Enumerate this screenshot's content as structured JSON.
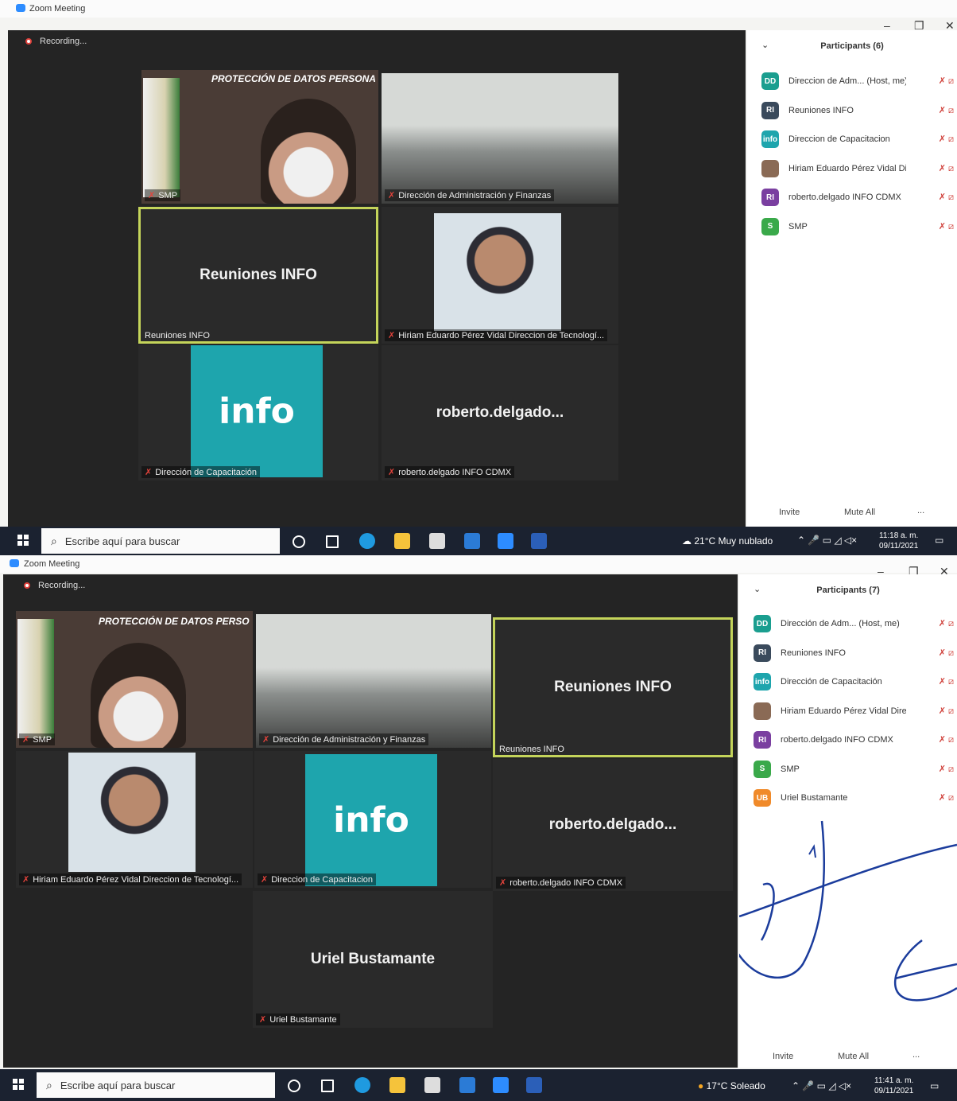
{
  "colors": {
    "accent": "#2d8cff",
    "muted_red": "#e3433b",
    "active_border": "#c4d45a",
    "info_teal": "#1ea5ad",
    "taskbar": "#1b2230"
  },
  "shot1": {
    "window_title": "Zoom Meeting",
    "recording": "Recording...",
    "banner": "PROTECCIÓN DE DATOS PERSONA",
    "tiles": {
      "smp": "SMP",
      "direccion_admin": "Dirección de Administración y Finanzas",
      "reuniones_big": "Reuniones INFO",
      "reuniones_label": "Reuniones INFO",
      "hiriam": "Hiriam Eduardo Pérez Vidal Direccion de Tecnologí...",
      "info_logo": "info",
      "capacitacion": "Dirección de Capacitación",
      "roberto_big": "roberto.delgado...",
      "roberto_label": "roberto.delgado INFO CDMX"
    },
    "participants_header": "Participants (6)",
    "participants": [
      {
        "initials": "DD",
        "name": "Direccion de Adm... (Host, me)",
        "color": "#1a9e8f"
      },
      {
        "initials": "RI",
        "name": "Reuniones INFO",
        "color": "#3a4a5c"
      },
      {
        "initials": "info",
        "name": "Direccion de Capacitacion",
        "color": "#1ea5ad"
      },
      {
        "initials": "",
        "name": "Hiriam Eduardo Pérez Vidal Dire...",
        "color": "#8a6a55"
      },
      {
        "initials": "RI",
        "name": "roberto.delgado INFO CDMX",
        "color": "#7a3fa0"
      },
      {
        "initials": "S",
        "name": "SMP",
        "color": "#3aa94a"
      }
    ],
    "invite": "Invite",
    "mute_all": "Mute All",
    "more": "...",
    "search_placeholder": "Escribe aquí para buscar",
    "weather": "21°C  Muy nublado",
    "time": "11:18 a. m.",
    "date": "09/11/2021"
  },
  "shot2": {
    "window_title": "Zoom Meeting",
    "recording": "Recording...",
    "banner": "PROTECCIÓN DE DATOS PERSO",
    "tiles": {
      "smp": "SMP",
      "direccion_admin": "Dirección de Administración y Finanzas",
      "reuniones_big": "Reuniones INFO",
      "reuniones_label": "Reuniones INFO",
      "hiriam": "Hiriam Eduardo Pérez Vidal Direccion de Tecnologí...",
      "info_logo": "info",
      "capacitacion": "Direccion de Capacitacion",
      "roberto_big": "roberto.delgado...",
      "roberto_label": "roberto.delgado INFO CDMX",
      "uriel_big": "Uriel Bustamante",
      "uriel_label": "Uriel Bustamante"
    },
    "participants_header": "Participants (7)",
    "participants": [
      {
        "initials": "DD",
        "name": "Dirección de Adm... (Host, me)",
        "color": "#1a9e8f"
      },
      {
        "initials": "RI",
        "name": "Reuniones INFO",
        "color": "#3a4a5c"
      },
      {
        "initials": "info",
        "name": "Dirección de Capacitación",
        "color": "#1ea5ad"
      },
      {
        "initials": "",
        "name": "Hiriam Eduardo Pérez Vidal Dire...",
        "color": "#8a6a55"
      },
      {
        "initials": "RI",
        "name": "roberto.delgado INFO CDMX",
        "color": "#7a3fa0"
      },
      {
        "initials": "S",
        "name": "SMP",
        "color": "#3aa94a"
      },
      {
        "initials": "UB",
        "name": "Uriel Bustamante",
        "color": "#f08a2a"
      }
    ],
    "invite": "Invite",
    "mute_all": "Mute All",
    "more": "...",
    "search_placeholder": "Escribe aquí para buscar",
    "weather": "17°C  Soleado",
    "time": "11:41 a. m.",
    "date": "09/11/2021"
  }
}
